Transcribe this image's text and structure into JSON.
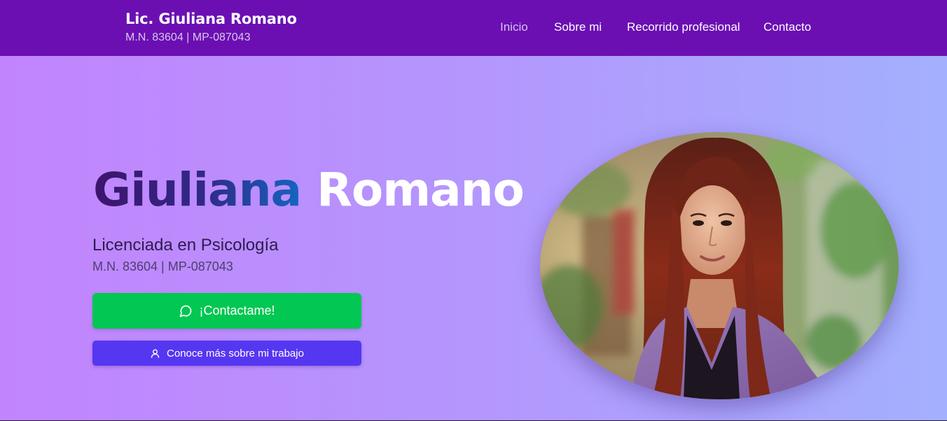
{
  "header": {
    "brand_name": "Lic. Giuliana Romano",
    "brand_sub": "M.N. 83604 | MP-087043",
    "nav": [
      {
        "label": "Inicio",
        "active": true
      },
      {
        "label": "Sobre mi",
        "active": false
      },
      {
        "label": "Recorrido profesional",
        "active": false
      },
      {
        "label": "Contacto",
        "active": false
      }
    ]
  },
  "hero": {
    "first_name": "Giuliana",
    "last_name": "Romano",
    "subtitle": "Licenciada en Psicología",
    "license": "M.N. 83604 | MP-087043",
    "contact_button": {
      "label": "¡Contactame!",
      "icon": "chat-bubble-icon"
    },
    "work_button": {
      "label": "Conoce más sobre mi trabajo",
      "icon": "user-icon"
    },
    "photo": {
      "subject": "portrait-photo"
    }
  },
  "colors": {
    "navbar": "#6b0fb3",
    "hero_gradient_start": "#c284fd",
    "hero_gradient_end": "#a3b0fd",
    "contact_button": "#02c752",
    "work_button": "#5537f2"
  }
}
